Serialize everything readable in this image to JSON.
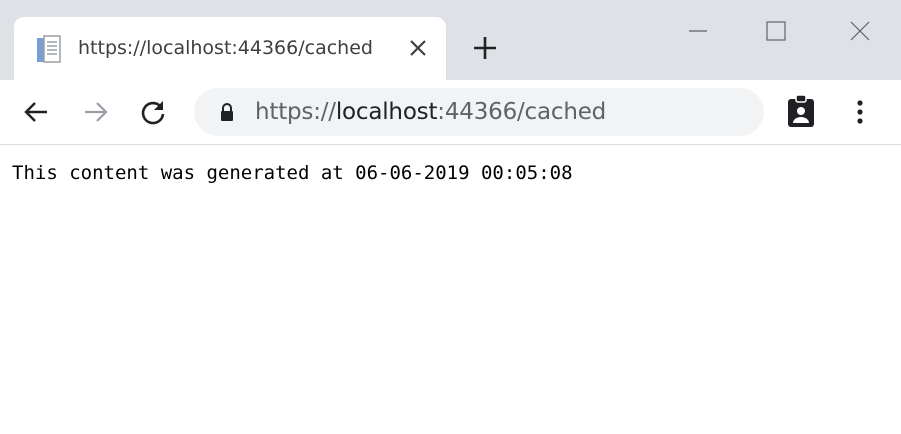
{
  "tab": {
    "title": "https://localhost:44366/cached",
    "favicon": "document-icon"
  },
  "toolbar": {
    "url_scheme": "https://",
    "url_host": "localhost",
    "url_rest": ":44366/cached"
  },
  "page": {
    "text": "This content was generated at 06-06-2019 00:05:08"
  }
}
